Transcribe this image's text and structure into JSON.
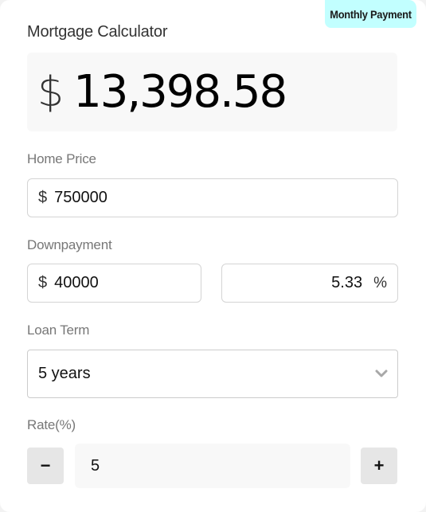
{
  "badge": {
    "label": "Monthly Payment"
  },
  "header": {
    "title": "Mortgage Calculator"
  },
  "payment": {
    "currency_symbol": "$",
    "amount": "13,398.58"
  },
  "home_price": {
    "label": "Home Price",
    "prefix": "$",
    "value": "750000"
  },
  "downpayment": {
    "label": "Downpayment",
    "amount_prefix": "$",
    "amount_value": "40000",
    "percent_value": "5.33",
    "percent_suffix": "%"
  },
  "loan_term": {
    "label": "Loan Term",
    "selected": "5 years",
    "icon": "chevron-down-icon"
  },
  "rate": {
    "label": "Rate(%)",
    "value": "5",
    "decrement_label": "−",
    "increment_label": "+"
  },
  "colors": {
    "badge_bg": "#c2ffff",
    "label_text": "#777777",
    "title_text": "#333333",
    "payment_box_bg": "#f8f8f8",
    "stepper_button_bg": "#e6e6e6"
  }
}
